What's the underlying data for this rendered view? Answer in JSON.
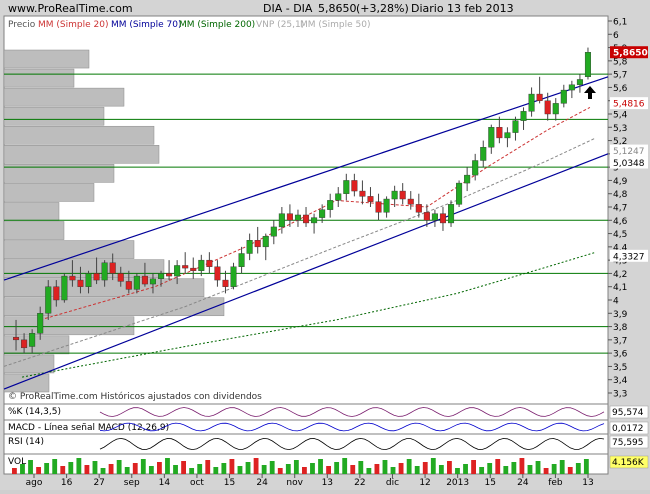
{
  "header": {
    "site": "www.ProRealTime.com",
    "instrument": "DIA - DIA",
    "price": "5,8650",
    "change": "(+3,28%)",
    "period": "Diario",
    "date": "13 feb 2013"
  },
  "legend": {
    "price": "Precio",
    "mm20": "MM (Simple 20)",
    "mm70": "MM (Simple 70)",
    "mm200": "MM (Simple 200)",
    "vnp": "VNP (25,1)",
    "mm50": "MM (Simple 50)"
  },
  "footer_note": "© ProRealTime.com   Históricos ajustados con dividendos",
  "colors": {
    "up": "#22aa22",
    "down": "#dd2222",
    "channel": "#000099",
    "mm20": "#cc3333",
    "mm70": "#888888",
    "mm200": "#006600",
    "levels": "#007700",
    "highlight": "#c80000"
  },
  "chart_data": {
    "type": "candlestick",
    "y_ticks": [
      "6,1",
      "6",
      "5,9",
      "5,8",
      "5,7",
      "5,6",
      "5,5",
      "5,4",
      "5,3",
      "5,2",
      "5,1",
      "5",
      "4,9",
      "4,8",
      "4,7",
      "4,6",
      "4,5",
      "4,4",
      "4,3",
      "4,2",
      "4,1",
      "4",
      "3,9",
      "3,8",
      "3,7",
      "3,6",
      "3,5",
      "3,4",
      "3,3"
    ],
    "ylim": [
      3.3,
      6.1
    ],
    "x_ticks": [
      "ago",
      "16",
      "27",
      "sep",
      "14",
      "oct",
      "15",
      "24",
      "nov",
      "13",
      "22",
      "dic",
      "12",
      "2013",
      "15",
      "24",
      "feb",
      "13"
    ],
    "price_labels": [
      {
        "value": 5.865,
        "text": "5,8650",
        "style": "highlight"
      },
      {
        "value": 5.4816,
        "text": "5,4816",
        "style": "red"
      },
      {
        "value": 5.1247,
        "text": "5,1247",
        "style": "gray"
      },
      {
        "value": 5.0348,
        "text": "5,0348",
        "style": "plain"
      },
      {
        "value": 4.3327,
        "text": "4,3327",
        "style": "plain"
      }
    ],
    "horizontal_levels": [
      5.7,
      5.36,
      5.0,
      4.6,
      4.2,
      3.8,
      3.6
    ],
    "trend_channel": {
      "upper": [
        [
          0,
          4.15
        ],
        [
          1,
          5.68
        ]
      ],
      "lower": [
        [
          0,
          3.33
        ],
        [
          1,
          5.1
        ]
      ]
    },
    "volume_profile": [
      0.85,
      0.7,
      1.2,
      1.0,
      1.5,
      1.55,
      1.1,
      0.9,
      0.55,
      0.6,
      1.3,
      1.6,
      2.0,
      2.2,
      1.3,
      0.65,
      0.5,
      0.45
    ],
    "series": [
      {
        "name": "MM (Simple 20)",
        "role": "mm20",
        "points": [
          [
            0.06,
            3.85
          ],
          [
            0.25,
            4.1
          ],
          [
            0.4,
            4.4
          ],
          [
            0.55,
            4.75
          ],
          [
            0.7,
            4.7
          ],
          [
            0.8,
            5.0
          ],
          [
            0.9,
            5.28
          ],
          [
            0.97,
            5.45
          ]
        ]
      },
      {
        "name": "MM (Simple 70)",
        "role": "mm70",
        "points": [
          [
            0.0,
            3.5
          ],
          [
            0.3,
            3.95
          ],
          [
            0.55,
            4.4
          ],
          [
            0.75,
            4.75
          ],
          [
            0.9,
            5.05
          ],
          [
            0.98,
            5.22
          ]
        ]
      },
      {
        "name": "MM (Simple 200)",
        "role": "mm200",
        "points": [
          [
            0.03,
            3.42
          ],
          [
            0.3,
            3.65
          ],
          [
            0.55,
            3.85
          ],
          [
            0.75,
            4.05
          ],
          [
            0.9,
            4.25
          ],
          [
            0.98,
            4.36
          ]
        ]
      }
    ],
    "ohlc": [
      [
        3.72,
        3.85,
        3.62,
        3.7
      ],
      [
        3.7,
        3.75,
        3.6,
        3.64
      ],
      [
        3.65,
        3.78,
        3.6,
        3.75
      ],
      [
        3.75,
        3.95,
        3.7,
        3.9
      ],
      [
        3.9,
        4.15,
        3.85,
        4.1
      ],
      [
        4.1,
        4.15,
        3.95,
        4.0
      ],
      [
        4.0,
        4.2,
        3.98,
        4.18
      ],
      [
        4.18,
        4.3,
        4.1,
        4.15
      ],
      [
        4.15,
        4.25,
        4.05,
        4.1
      ],
      [
        4.1,
        4.22,
        4.05,
        4.2
      ],
      [
        4.2,
        4.32,
        4.12,
        4.15
      ],
      [
        4.15,
        4.3,
        4.1,
        4.28
      ],
      [
        4.28,
        4.35,
        4.15,
        4.2
      ],
      [
        4.2,
        4.25,
        4.1,
        4.14
      ],
      [
        4.14,
        4.22,
        4.05,
        4.08
      ],
      [
        4.08,
        4.2,
        4.05,
        4.18
      ],
      [
        4.18,
        4.28,
        4.1,
        4.12
      ],
      [
        4.12,
        4.2,
        4.05,
        4.16
      ],
      [
        4.16,
        4.22,
        4.1,
        4.2
      ],
      [
        4.2,
        4.3,
        4.15,
        4.18
      ],
      [
        4.18,
        4.3,
        4.12,
        4.26
      ],
      [
        4.26,
        4.36,
        4.2,
        4.24
      ],
      [
        4.24,
        4.32,
        4.16,
        4.22
      ],
      [
        4.22,
        4.34,
        4.18,
        4.3
      ],
      [
        4.3,
        4.36,
        4.2,
        4.25
      ],
      [
        4.25,
        4.3,
        4.1,
        4.15
      ],
      [
        4.15,
        4.22,
        4.05,
        4.1
      ],
      [
        4.1,
        4.28,
        4.08,
        4.25
      ],
      [
        4.25,
        4.4,
        4.2,
        4.35
      ],
      [
        4.35,
        4.5,
        4.3,
        4.45
      ],
      [
        4.45,
        4.55,
        4.35,
        4.4
      ],
      [
        4.4,
        4.5,
        4.3,
        4.48
      ],
      [
        4.48,
        4.6,
        4.42,
        4.55
      ],
      [
        4.55,
        4.7,
        4.5,
        4.65
      ],
      [
        4.65,
        4.72,
        4.55,
        4.6
      ],
      [
        4.6,
        4.68,
        4.55,
        4.64
      ],
      [
        4.64,
        4.7,
        4.55,
        4.58
      ],
      [
        4.58,
        4.65,
        4.5,
        4.62
      ],
      [
        4.62,
        4.72,
        4.58,
        4.68
      ],
      [
        4.68,
        4.8,
        4.62,
        4.75
      ],
      [
        4.75,
        4.85,
        4.7,
        4.8
      ],
      [
        4.8,
        4.95,
        4.75,
        4.9
      ],
      [
        4.9,
        4.95,
        4.78,
        4.82
      ],
      [
        4.82,
        4.9,
        4.72,
        4.78
      ],
      [
        4.78,
        4.85,
        4.7,
        4.74
      ],
      [
        4.74,
        4.8,
        4.6,
        4.66
      ],
      [
        4.66,
        4.78,
        4.62,
        4.76
      ],
      [
        4.76,
        4.86,
        4.7,
        4.82
      ],
      [
        4.82,
        4.88,
        4.72,
        4.76
      ],
      [
        4.76,
        4.82,
        4.68,
        4.72
      ],
      [
        4.72,
        4.8,
        4.62,
        4.66
      ],
      [
        4.66,
        4.72,
        4.55,
        4.6
      ],
      [
        4.6,
        4.68,
        4.55,
        4.65
      ],
      [
        4.65,
        4.7,
        4.52,
        4.58
      ],
      [
        4.58,
        4.75,
        4.55,
        4.72
      ],
      [
        4.72,
        4.9,
        4.7,
        4.88
      ],
      [
        4.88,
        5.0,
        4.82,
        4.94
      ],
      [
        4.94,
        5.1,
        4.9,
        5.05
      ],
      [
        5.05,
        5.2,
        5.0,
        5.15
      ],
      [
        5.15,
        5.32,
        5.1,
        5.3
      ],
      [
        5.3,
        5.38,
        5.18,
        5.22
      ],
      [
        5.22,
        5.3,
        5.15,
        5.26
      ],
      [
        5.26,
        5.38,
        5.2,
        5.35
      ],
      [
        5.35,
        5.45,
        5.28,
        5.42
      ],
      [
        5.42,
        5.6,
        5.38,
        5.55
      ],
      [
        5.55,
        5.68,
        5.48,
        5.5
      ],
      [
        5.5,
        5.56,
        5.35,
        5.4
      ],
      [
        5.4,
        5.52,
        5.35,
        5.48
      ],
      [
        5.48,
        5.62,
        5.45,
        5.58
      ],
      [
        5.58,
        5.65,
        5.52,
        5.62
      ],
      [
        5.62,
        5.7,
        5.56,
        5.66
      ],
      [
        5.68,
        5.9,
        5.66,
        5.865
      ]
    ],
    "indicators": [
      {
        "name": "%K",
        "label": "%K (14,3,5)",
        "value": "95,574",
        "color": "#7a1e6e"
      },
      {
        "name": "MACD",
        "label": "MACD - Línea señal  MACD (12,26,9)",
        "value": "0,0172",
        "color": "#0000cc"
      },
      {
        "name": "RSI",
        "label": "RSI (14)",
        "value": "75,595",
        "color": "#000000"
      },
      {
        "name": "VOL",
        "label": "VOL",
        "value": "4.156K",
        "color": "#22aa22"
      }
    ]
  }
}
